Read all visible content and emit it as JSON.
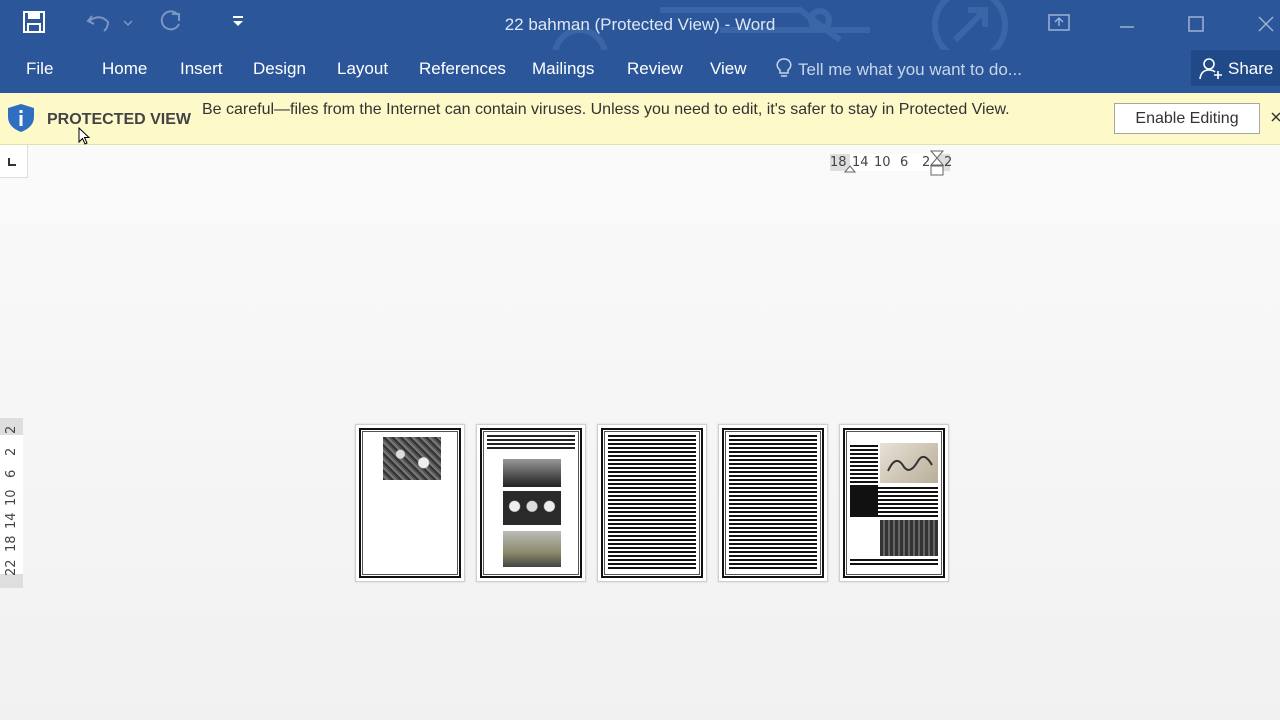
{
  "window": {
    "title": "22 bahman (Protected View) - Word"
  },
  "ribbon": {
    "tabs": [
      "File",
      "Home",
      "Insert",
      "Design",
      "Layout",
      "References",
      "Mailings",
      "Review",
      "View"
    ],
    "tell_me_placeholder": "Tell me what you want to do...",
    "share_label": "Share"
  },
  "protected_view": {
    "label": "PROTECTED VIEW",
    "message": "Be careful—files from the Internet can contain viruses. Unless you need to edit, it's safer to stay in Protected View.",
    "enable_button": "Enable Editing"
  },
  "ruler": {
    "horizontal": [
      "18",
      "14",
      "10",
      "6",
      "2",
      "2"
    ],
    "vertical": [
      "2",
      "2",
      "6",
      "10",
      "14",
      "18",
      "22"
    ]
  },
  "document": {
    "page_count": 5
  },
  "colors": {
    "titlebar": "#2b579a",
    "protected_bar": "#fdf9c9",
    "share_button": "#1f4a87"
  },
  "icons": [
    "save-icon",
    "undo-icon",
    "redo-icon",
    "customize-qat-icon",
    "ribbon-display-icon",
    "minimize-icon",
    "maximize-icon",
    "close-icon",
    "lightbulb-icon",
    "share-person-icon",
    "shield-icon",
    "dismiss-icon",
    "tab-stop-icon"
  ]
}
